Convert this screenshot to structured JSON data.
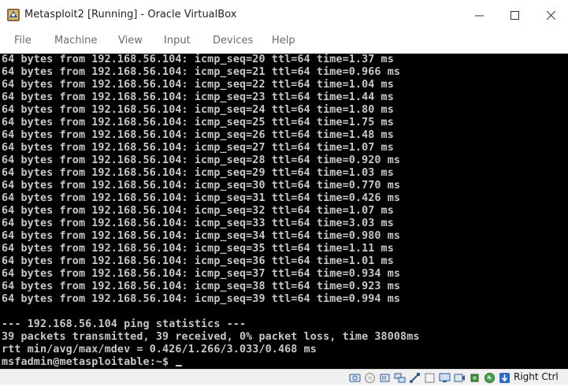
{
  "window": {
    "title": "Metasploit2 [Running] - Oracle VirtualBox",
    "icon": "virtualbox-app-icon",
    "controls": [
      "minimize",
      "maximize",
      "close"
    ]
  },
  "menu": [
    "File",
    "Machine",
    "View",
    "Input",
    "Devices",
    "Help"
  ],
  "terminal": {
    "lines": [
      "64 bytes from 192.168.56.104: icmp_seq=20 ttl=64 time=1.37 ms",
      "64 bytes from 192.168.56.104: icmp_seq=21 ttl=64 time=0.966 ms",
      "64 bytes from 192.168.56.104: icmp_seq=22 ttl=64 time=1.04 ms",
      "64 bytes from 192.168.56.104: icmp_seq=23 ttl=64 time=1.44 ms",
      "64 bytes from 192.168.56.104: icmp_seq=24 ttl=64 time=1.80 ms",
      "64 bytes from 192.168.56.104: icmp_seq=25 ttl=64 time=1.75 ms",
      "64 bytes from 192.168.56.104: icmp_seq=26 ttl=64 time=1.48 ms",
      "64 bytes from 192.168.56.104: icmp_seq=27 ttl=64 time=1.07 ms",
      "64 bytes from 192.168.56.104: icmp_seq=28 ttl=64 time=0.920 ms",
      "64 bytes from 192.168.56.104: icmp_seq=29 ttl=64 time=1.03 ms",
      "64 bytes from 192.168.56.104: icmp_seq=30 ttl=64 time=0.770 ms",
      "64 bytes from 192.168.56.104: icmp_seq=31 ttl=64 time=0.426 ms",
      "64 bytes from 192.168.56.104: icmp_seq=32 ttl=64 time=1.07 ms",
      "64 bytes from 192.168.56.104: icmp_seq=33 ttl=64 time=3.03 ms",
      "64 bytes from 192.168.56.104: icmp_seq=34 ttl=64 time=0.980 ms",
      "64 bytes from 192.168.56.104: icmp_seq=35 ttl=64 time=1.11 ms",
      "64 bytes from 192.168.56.104: icmp_seq=36 ttl=64 time=1.01 ms",
      "64 bytes from 192.168.56.104: icmp_seq=37 ttl=64 time=0.934 ms",
      "64 bytes from 192.168.56.104: icmp_seq=38 ttl=64 time=0.923 ms",
      "64 bytes from 192.168.56.104: icmp_seq=39 ttl=64 time=0.994 ms",
      "",
      "--- 192.168.56.104 ping statistics ---",
      "39 packets transmitted, 39 received, 0% packet loss, time 38008ms",
      "rtt min/avg/max/mdev = 0.426/1.266/3.033/0.468 ms",
      "msfadmin@metasploitable:~$ "
    ],
    "text_color": "#c8c8c8",
    "background": "#000000"
  },
  "statusbar": {
    "icons": [
      "hard-disk-icon",
      "optical-drive-icon",
      "audio-icon",
      "network-icon",
      "usb-icon",
      "shared-folders-icon",
      "display-icon",
      "video-capture-icon",
      "cpu-icon",
      "mouse-integration-icon",
      "keyboard-capture-icon"
    ],
    "host_key": "Right Ctrl"
  }
}
